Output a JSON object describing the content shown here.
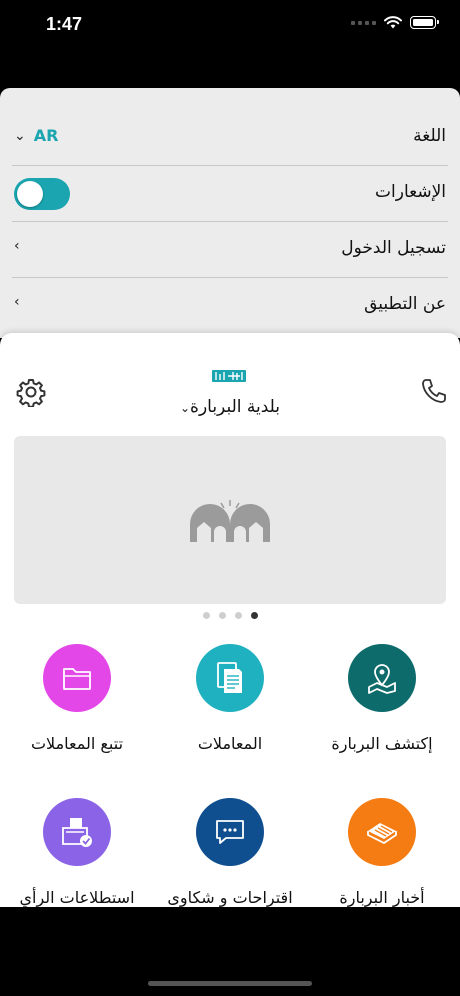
{
  "status_bar": {
    "time": "1:47"
  },
  "settings": {
    "language_label": "اللغة",
    "language_value": "AR",
    "notifications_label": "الإشعارات",
    "notifications_on": true,
    "login_label": "تسجيل الدخول",
    "about_label": "عن التطبيق"
  },
  "header": {
    "municipality": "بلدية البربارة",
    "logo_text": "البربارة"
  },
  "carousel": {
    "pages": 4,
    "active_index": 3
  },
  "tiles": [
    {
      "label": "إكتشف البربارة",
      "icon": "map-pin-icon",
      "color": "#0e6b6b"
    },
    {
      "label": "المعاملات",
      "icon": "document-icon",
      "color": "#1fb1bf"
    },
    {
      "label": "تتبع المعاملات",
      "icon": "folder-icon",
      "color": "#e447e8"
    },
    {
      "label": "أخبار البربارة",
      "icon": "news-icon",
      "color": "#f57c13"
    },
    {
      "label": "اقتراحات و شكاوى",
      "icon": "chat-icon",
      "color": "#0f4f8f"
    },
    {
      "label": "استطلاعات الرأي",
      "icon": "ballot-box-icon",
      "color": "#8a63e6"
    }
  ],
  "colors": {
    "accent": "#1aa5b0",
    "settings_bg": "#ececec"
  }
}
